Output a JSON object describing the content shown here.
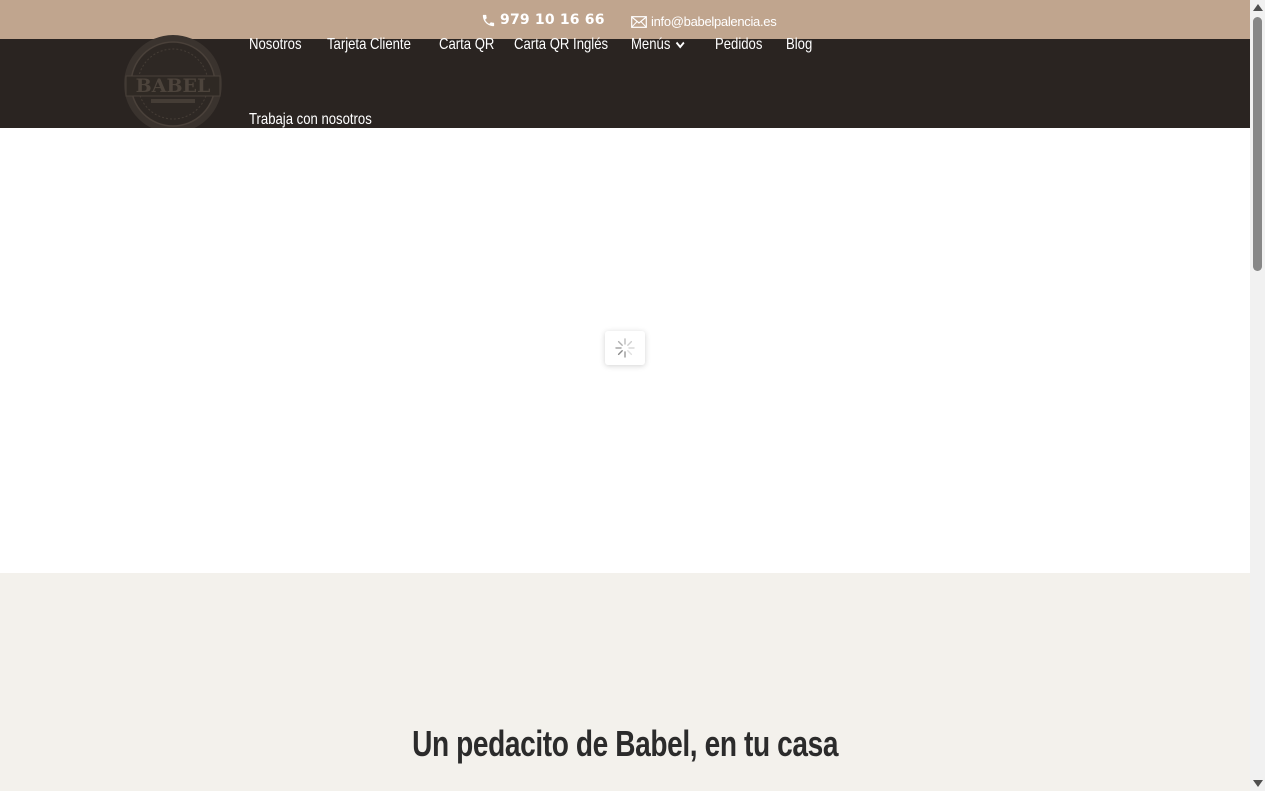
{
  "topbar": {
    "phone": "979 10 16 66",
    "email": "info@babelpalencia.es",
    "icons": [
      "phone-icon",
      "mail-icon"
    ],
    "background": "#c0a58e"
  },
  "header": {
    "logo_text": "BABEL",
    "background": "#2a2421",
    "nav": [
      {
        "label": "Nosotros"
      },
      {
        "label": "Tarjeta Cliente"
      },
      {
        "label": "Carta QR"
      },
      {
        "label": "Carta QR Inglés"
      },
      {
        "label": "Menús",
        "has_dropdown": true
      },
      {
        "label": "Pedidos"
      },
      {
        "label": "Blog"
      },
      {
        "label": "Trabaja con nosotros"
      }
    ]
  },
  "loader": {
    "icon": "loading-spinner-icon"
  },
  "section": {
    "heading": "Un pedacito de Babel, en tu casa",
    "background": "#f3f1ec"
  }
}
